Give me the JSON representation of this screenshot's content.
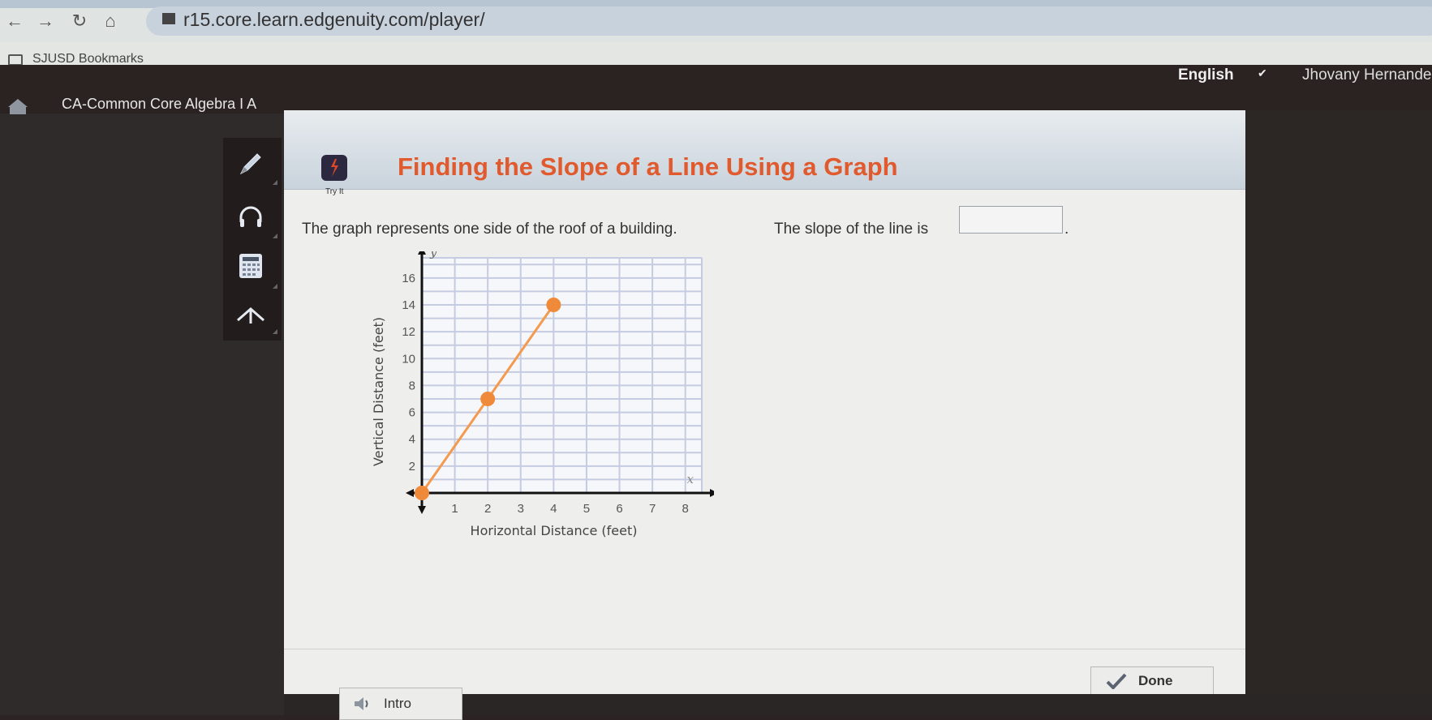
{
  "browser": {
    "url": "r15.core.learn.edgenuity.com/player/",
    "bookmarks_folder": "SJUSD Bookmarks",
    "nav_icons": [
      "back-arrow-icon",
      "forward-arrow-icon",
      "reload-icon",
      "home-icon"
    ]
  },
  "header": {
    "course_title": "CA-Common Core Algebra I A",
    "language": "English",
    "user_name": "Jhovany Hernandez"
  },
  "tools": [
    "pencil-icon",
    "headphones-icon",
    "calculator-icon",
    "formula-icon"
  ],
  "lesson": {
    "activity_label": "Try It",
    "title": "Finding the Slope of a Line Using a Graph",
    "prompt": "The graph represents one side of the roof of a building.",
    "question": "The slope of the line is",
    "answer_value": "",
    "question_end": "."
  },
  "footer": {
    "intro_label": "Intro",
    "done_label": "Done"
  },
  "colors": {
    "title_orange": "#e05a2e",
    "line_orange": "#f39a4f",
    "point_orange": "#ef8a3a",
    "grid": "#c5cbe0"
  },
  "chart_data": {
    "type": "line",
    "title": "",
    "xlabel": "Horizontal Distance (feet)",
    "ylabel": "Vertical Distance (feet)",
    "x_axis_var": "x",
    "y_axis_var": "y",
    "xlim": [
      0,
      8.5
    ],
    "ylim": [
      0,
      17.5
    ],
    "x_ticks": [
      1,
      2,
      3,
      4,
      5,
      6,
      7,
      8
    ],
    "y_ticks": [
      2,
      4,
      6,
      8,
      10,
      12,
      14,
      16
    ],
    "grid": true,
    "series": [
      {
        "name": "roof",
        "points": [
          {
            "x": 0,
            "y": 0
          },
          {
            "x": 2,
            "y": 7
          },
          {
            "x": 4,
            "y": 14
          }
        ],
        "marked_points": [
          {
            "x": 0,
            "y": 0
          },
          {
            "x": 2,
            "y": 7
          },
          {
            "x": 4,
            "y": 14
          }
        ]
      }
    ]
  }
}
